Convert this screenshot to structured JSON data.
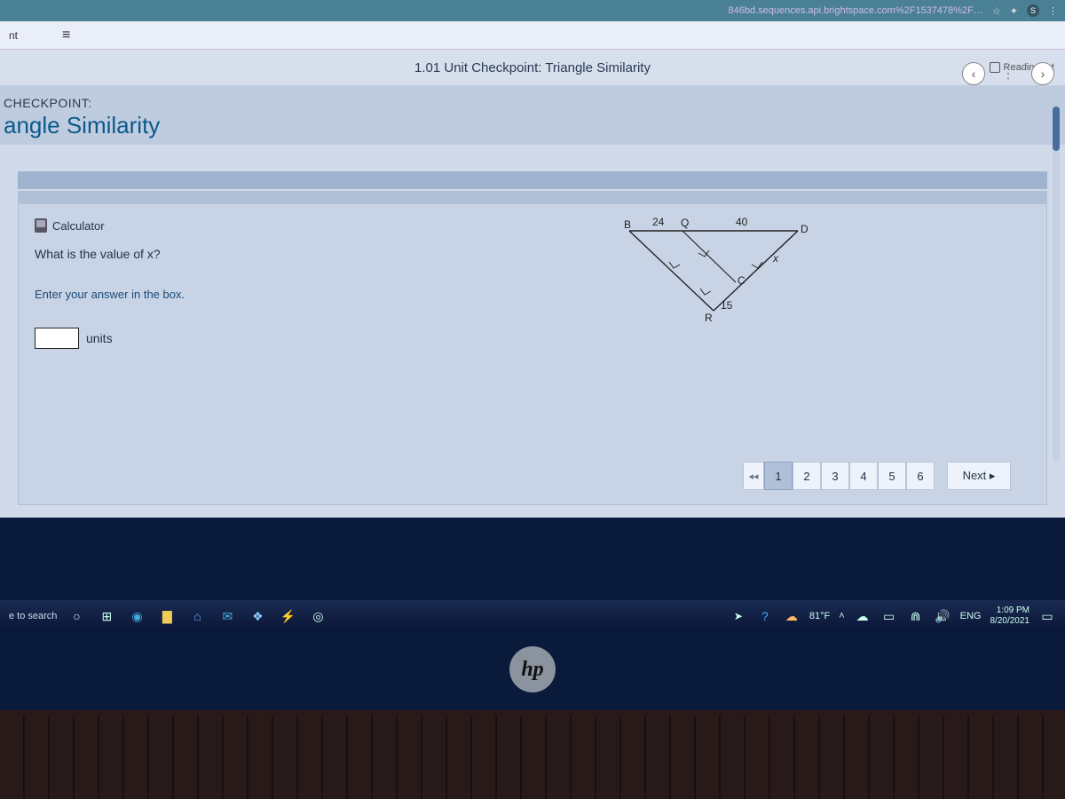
{
  "browser": {
    "url": "846bd.sequences.api.brightspace.com%2F1537478%2F…",
    "reading_list": "Reading list"
  },
  "assessment": {
    "title": "1.01 Unit Checkpoint: Triangle Similarity"
  },
  "header": {
    "checkpoint_label": "CHECKPOINT:",
    "checkpoint_title": "angle Similarity",
    "partial_prefix": "nt"
  },
  "question": {
    "calculator_label": "Calculator",
    "prompt": "What is the value of x?",
    "instruction": "Enter your answer in the box.",
    "units_label": "units",
    "answer_value": ""
  },
  "diagram": {
    "B": "B",
    "Q": "Q",
    "D": "D",
    "C": "C",
    "R": "R",
    "BQ": "24",
    "QD": "40",
    "RC": "15",
    "x_label": "x"
  },
  "pager": {
    "pages": [
      "1",
      "2",
      "3",
      "4",
      "5",
      "6"
    ],
    "current": "1",
    "next_label": "Next ▸",
    "rewind": "◂◂"
  },
  "taskbar": {
    "search_placeholder": "e to search",
    "temperature": "81°F",
    "lang": "ENG",
    "time": "1:09 PM",
    "date": "8/20/2021"
  },
  "chart_data": {
    "type": "diagram",
    "description": "Two similar triangles sharing vertex. BQD is top line with BQ=24 and QD=40. R is on BC extension with RC=15, x is unknown side CD.",
    "points": [
      "B",
      "Q",
      "D",
      "R",
      "C"
    ],
    "segments": {
      "BQ": 24,
      "QD": 40,
      "RC": 15,
      "CD": "x"
    }
  }
}
